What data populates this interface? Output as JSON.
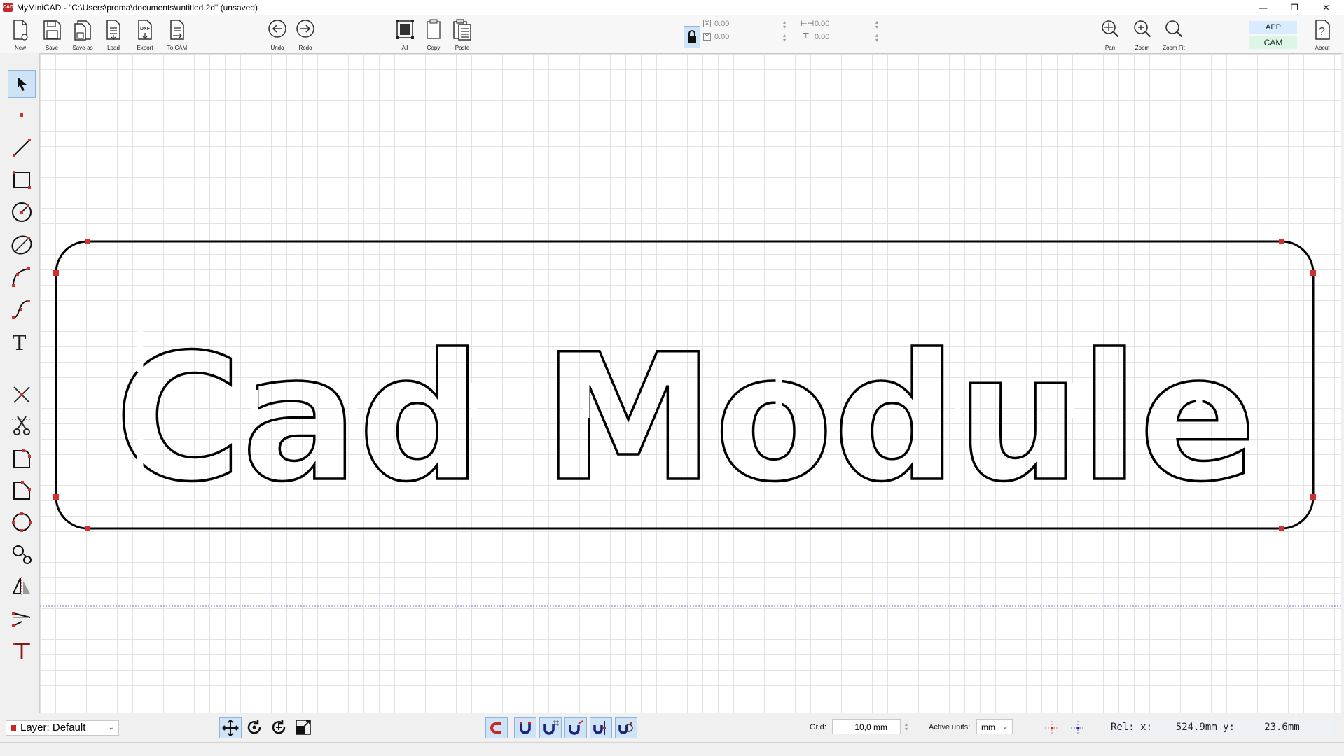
{
  "window": {
    "app_logo": "CAD",
    "title": "MyMiniCAD - \"C:\\Users\\proma\\documents\\untitled.2d\" (unsaved)",
    "controls": {
      "minimize": "—",
      "restore": "❐",
      "close": "✕"
    }
  },
  "toolbar": {
    "file": [
      {
        "label": "New",
        "icon": "new-file-icon"
      },
      {
        "label": "Save",
        "icon": "save-icon"
      },
      {
        "label": "Save-as",
        "icon": "save-as-icon"
      },
      {
        "label": "Load",
        "icon": "load-icon"
      },
      {
        "label": "Export",
        "icon": "export-dxf-icon"
      },
      {
        "label": "To CAM",
        "icon": "to-cam-icon"
      }
    ],
    "history": [
      {
        "label": "Undo",
        "icon": "undo-icon"
      },
      {
        "label": "Redo",
        "icon": "redo-icon"
      }
    ],
    "edit": [
      {
        "label": "All",
        "icon": "select-all-icon"
      },
      {
        "label": "Copy",
        "icon": "copy-icon"
      },
      {
        "label": "Paste",
        "icon": "paste-icon"
      }
    ],
    "coords": {
      "x": "0.00",
      "y": "0.00",
      "width": "0.00",
      "height": "0.00"
    },
    "view": [
      {
        "label": "Pan",
        "icon": "pan-icon"
      },
      {
        "label": "Zoom",
        "icon": "zoom-icon"
      },
      {
        "label": "Zoom Fit",
        "icon": "zoom-fit-icon"
      }
    ],
    "modes": {
      "app": "APP",
      "cam": "CAM"
    },
    "about": "About"
  },
  "left_tools": [
    {
      "name": "select-tool",
      "icon": "arrow-icon",
      "active": true
    },
    {
      "name": "point-tool",
      "icon": "point-icon"
    },
    {
      "name": "line-tool",
      "icon": "line-icon"
    },
    {
      "name": "rectangle-tool",
      "icon": "rectangle-icon"
    },
    {
      "name": "circle-tool",
      "icon": "circle-icon"
    },
    {
      "name": "ellipse-tool",
      "icon": "ellipse-icon"
    },
    {
      "name": "arc-tool",
      "icon": "arc-icon"
    },
    {
      "name": "spline-tool",
      "icon": "spline-icon"
    },
    {
      "name": "text-tool",
      "icon": "text-icon"
    },
    {
      "name": "delete-tool",
      "icon": "delete-cross-icon"
    },
    {
      "name": "trim-tool",
      "icon": "scissors-icon"
    },
    {
      "name": "fillet-tool",
      "icon": "fillet-icon"
    },
    {
      "name": "chamfer-tool",
      "icon": "chamfer-icon"
    },
    {
      "name": "offset-tool",
      "icon": "offset-icon"
    },
    {
      "name": "tangent-tool",
      "icon": "tangent-icon"
    },
    {
      "name": "mirror-tool",
      "icon": "mirror-icon"
    },
    {
      "name": "extend-tool",
      "icon": "extend-icon"
    },
    {
      "name": "text-edit-tool",
      "icon": "text-edit-icon"
    }
  ],
  "canvas": {
    "text": "Cad Module",
    "text_color": "#000000",
    "handle_color": "#d32f2f"
  },
  "status": {
    "layer": "Layer: Default",
    "grid_label": "Grid:",
    "grid_value": "10,0 mm",
    "units_label": "Active units:",
    "units_value": "mm",
    "readout": "Rel: x:    524.9mm y:     23.6mm"
  }
}
